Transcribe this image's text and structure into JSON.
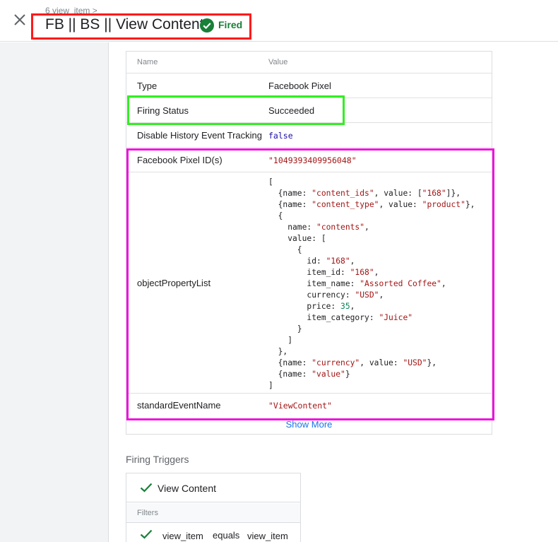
{
  "header": {
    "breadcrumb": "6 view_item >",
    "title": "FB || BS || View Content",
    "status": "Fired",
    "close_icon": "close-icon",
    "status_icon": "check-circle-icon"
  },
  "table": {
    "col_name": "Name",
    "col_value": "Value",
    "rows": {
      "type": {
        "name": "Type",
        "value": "Facebook Pixel"
      },
      "firing_status": {
        "name": "Firing Status",
        "value": "Succeeded"
      },
      "history": {
        "name": "Disable History Event Tracking",
        "value": "false"
      },
      "pixel_id": {
        "name": "Facebook Pixel ID(s)",
        "value": "\"1049393409956048\""
      },
      "object_property_list": {
        "name": "objectPropertyList"
      },
      "standard_event": {
        "name": "standardEventName",
        "value": "\"ViewContent\""
      }
    },
    "code": {
      "l1": "[",
      "l2a": "  {name: ",
      "l2b": "\"content_ids\"",
      "l2c": ", value: [",
      "l2d": "\"168\"",
      "l2e": "]},",
      "l3a": "  {name: ",
      "l3b": "\"content_type\"",
      "l3c": ", value: ",
      "l3d": "\"product\"",
      "l3e": "},",
      "l4": "  {",
      "l5a": "    name: ",
      "l5b": "\"contents\"",
      "l5c": ",",
      "l6": "    value: [",
      "l7": "      {",
      "l8a": "        id: ",
      "l8b": "\"168\"",
      "l8c": ",",
      "l9a": "        item_id: ",
      "l9b": "\"168\"",
      "l9c": ",",
      "l10a": "        item_name: ",
      "l10b": "\"Assorted Coffee\"",
      "l10c": ",",
      "l11a": "        currency: ",
      "l11b": "\"USD\"",
      "l11c": ",",
      "l12a": "        price: ",
      "l12b": "35",
      "l12c": ",",
      "l13a": "        item_category: ",
      "l13b": "\"Juice\"",
      "l14": "      }",
      "l15": "    ]",
      "l16": "  },",
      "l17a": "  {name: ",
      "l17b": "\"currency\"",
      "l17c": ", value: ",
      "l17d": "\"USD\"",
      "l17e": "},",
      "l18a": "  {name: ",
      "l18b": "\"value\"",
      "l18c": "}",
      "l19": "]"
    },
    "show_more": "Show More"
  },
  "triggers": {
    "section_title": "Firing Triggers",
    "trigger_name": "View Content",
    "filters_label": "Filters",
    "filter": {
      "variable": "view_item",
      "operator": "equals",
      "value": "view_item"
    },
    "check_icon": "checkmark-icon"
  },
  "colors": {
    "fired_green": "#188038",
    "link_blue": "#1a73e8",
    "highlight_red": "#ff1a1a",
    "highlight_green": "#33ee22",
    "highlight_magenta": "#ee11dd"
  }
}
